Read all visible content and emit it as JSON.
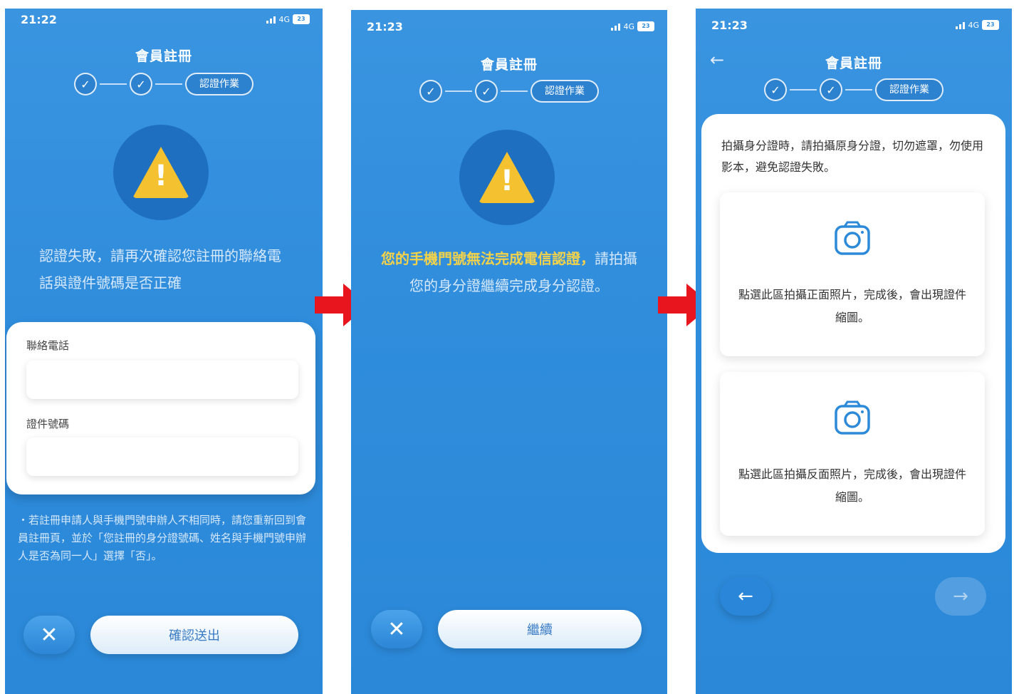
{
  "screens": [
    {
      "status_time": "21:22",
      "network": "4G",
      "battery": "23",
      "title": "會員註冊",
      "step_current": "認證作業",
      "message": "認證失敗，請再次確認您註冊的聯絡電話與證件號碼是否正確",
      "form": {
        "phone_label": "聯絡電話",
        "id_label": "證件號碼"
      },
      "note": "・若註冊申請人與手機門號申辦人不相同時，請您重新回到會員註冊頁，並於「您註冊的身分證號碼、姓名與手機門號申辦人是否為同一人」選擇「否」。",
      "submit_label": "確認送出"
    },
    {
      "status_time": "21:23",
      "network": "4G",
      "battery": "23",
      "title": "會員註冊",
      "step_current": "認證作業",
      "message_highlight": "您的手機門號無法完成電信認證，",
      "message_rest": "請拍攝您的身分證繼續完成身分認證。",
      "continue_label": "繼續"
    },
    {
      "status_time": "21:23",
      "network": "4G",
      "battery": "23",
      "title": "會員註冊",
      "step_current": "認證作業",
      "hint": "拍攝身分證時，請拍攝原身分證，切勿遮罩，勿使用影本，避免認證失敗。",
      "front_text": "點選此區拍攝正面照片，完成後，會出現證件縮圖。",
      "back_text": "點選此區拍攝反面照片，完成後，會出現證件縮圖。"
    }
  ],
  "icons": {
    "check": "✓",
    "close": "✕",
    "left_arrow": "←",
    "right_arrow": "→"
  },
  "colors": {
    "screen_bg": "#2f8ddc",
    "warning": "#f4c230",
    "highlight_text": "#f2d24a",
    "red_arrow": "#e8141e"
  }
}
